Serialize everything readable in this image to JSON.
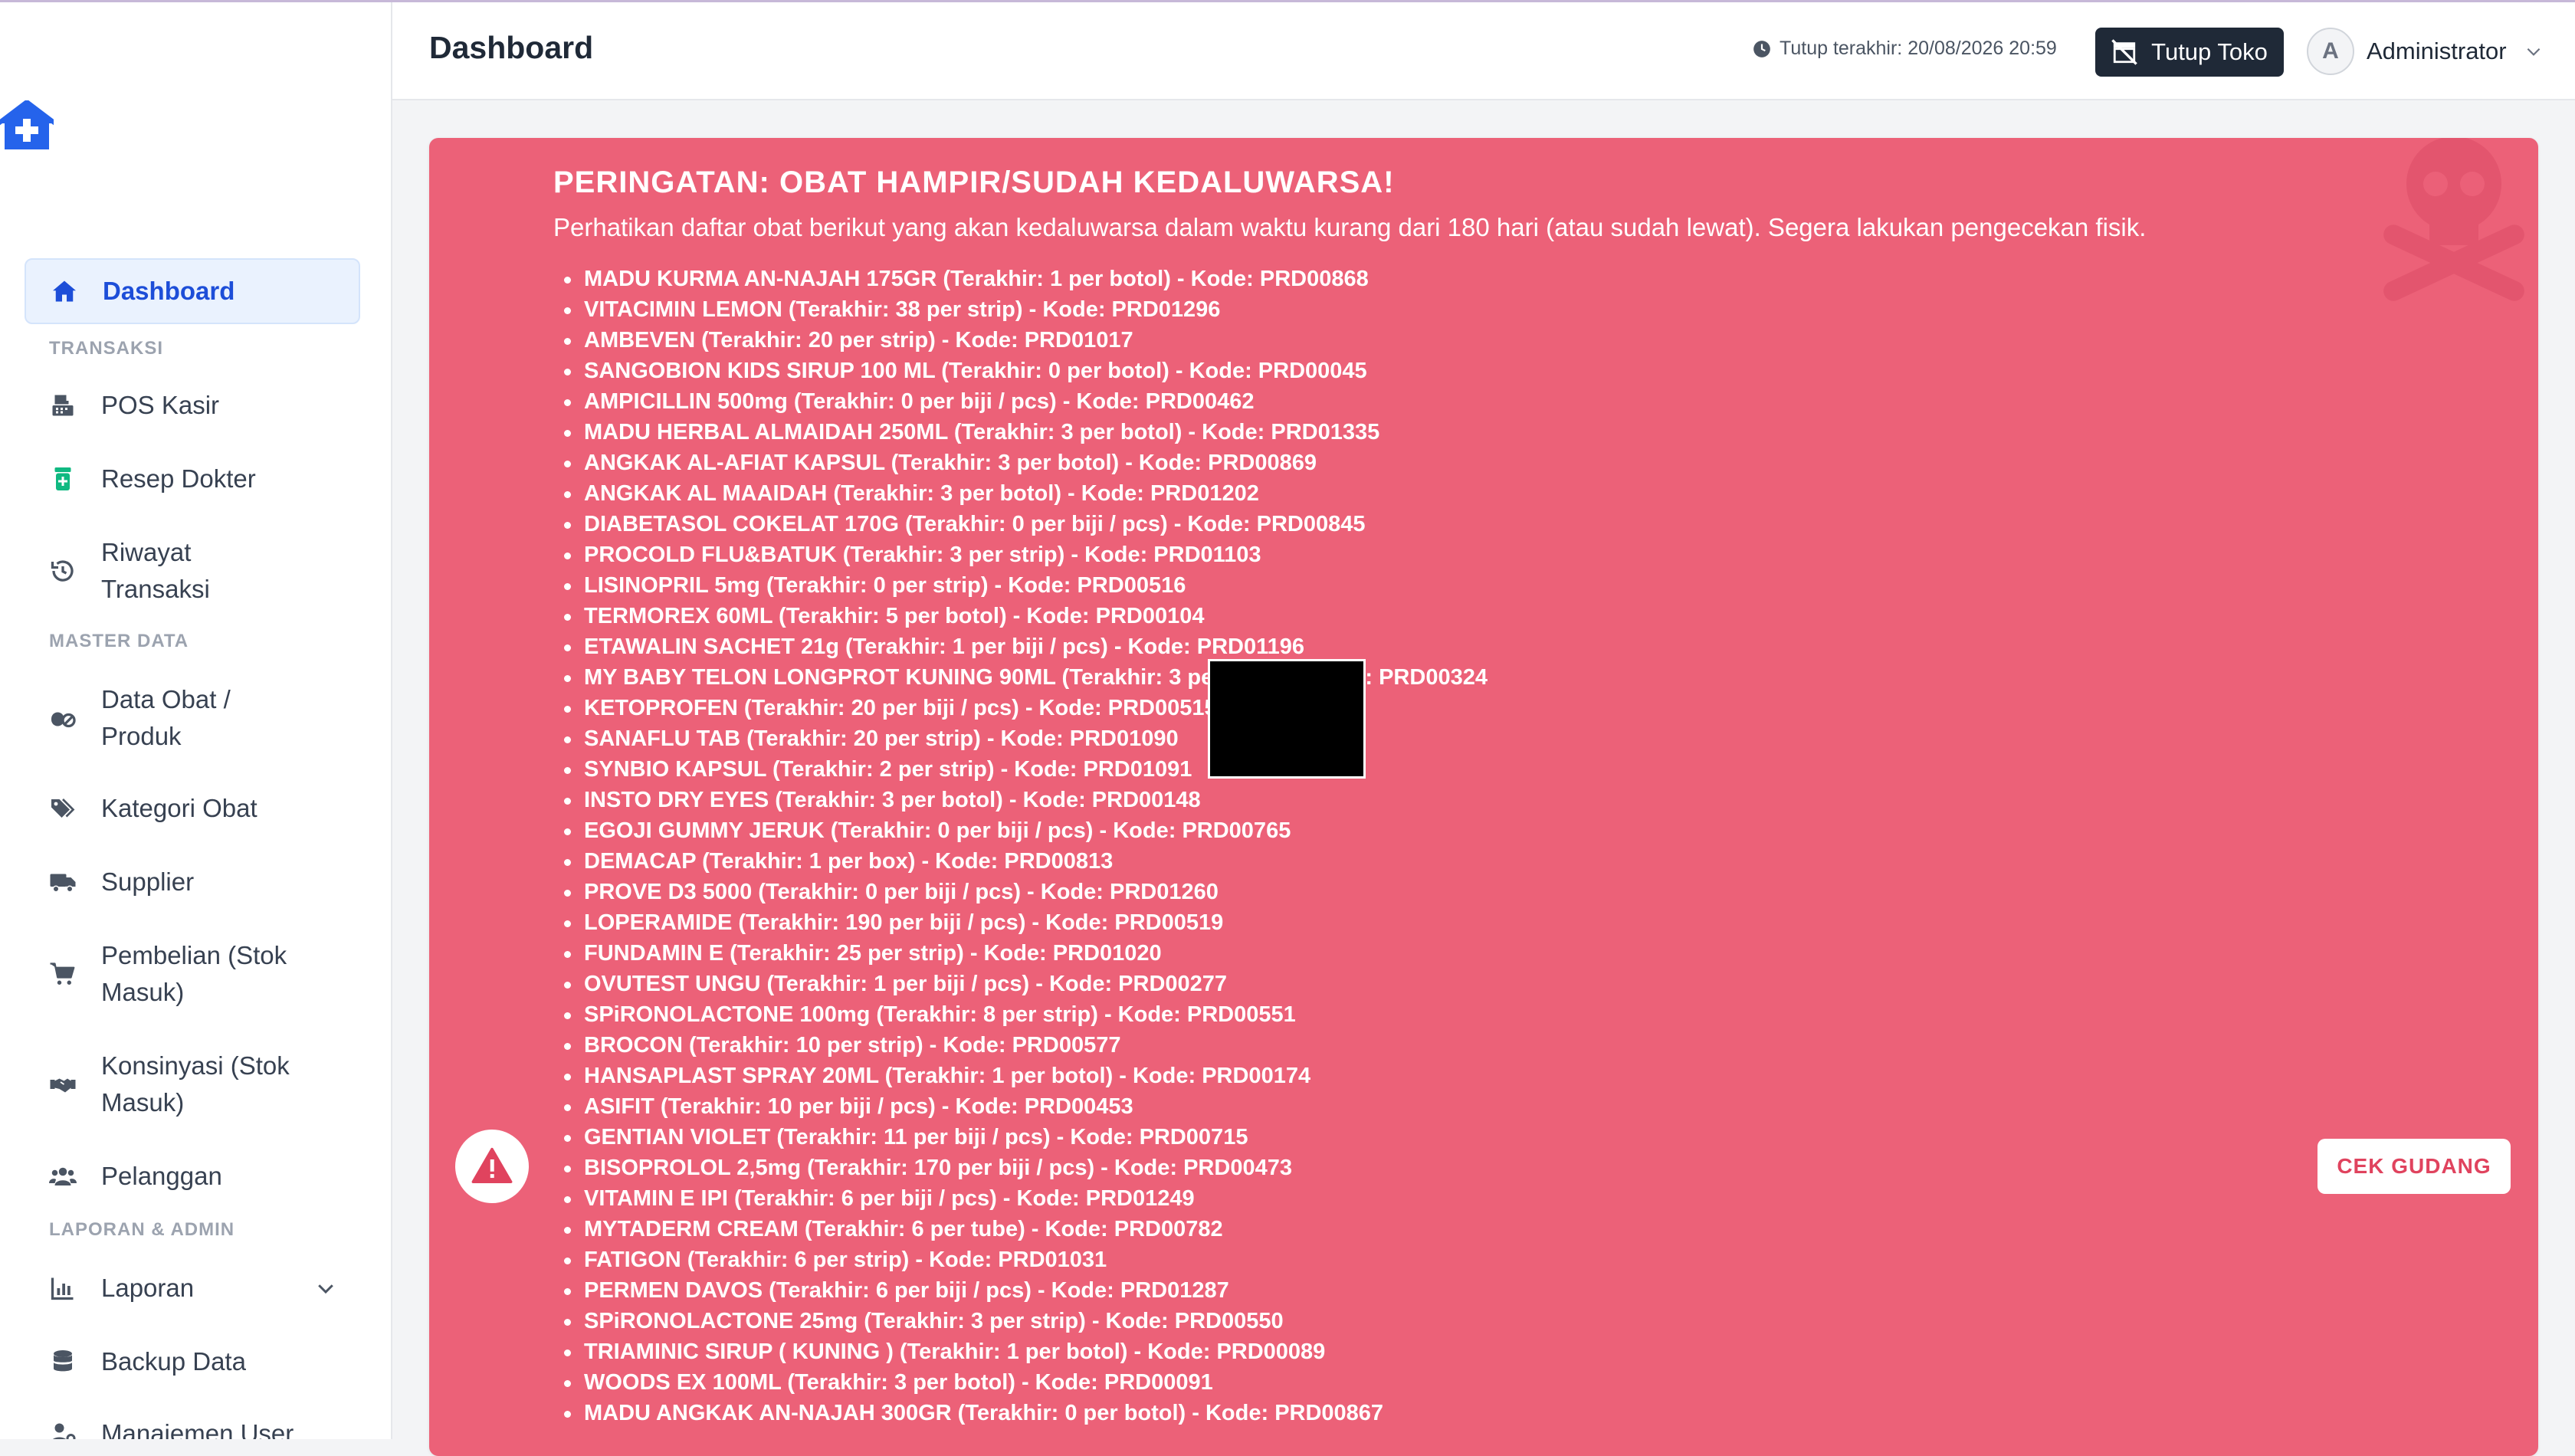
{
  "sidebar": {
    "sections": {
      "transaksi": "TRANSAKSI",
      "master": "MASTER DATA",
      "laporan": "LAPORAN & ADMIN"
    },
    "items": [
      {
        "label": "Dashboard",
        "icon": "home-icon"
      },
      {
        "label": "POS Kasir",
        "icon": "cash-register-icon"
      },
      {
        "label": "Resep Dokter",
        "icon": "prescription-icon"
      },
      {
        "label": "Riwayat\nTransaksi",
        "icon": "history-icon"
      },
      {
        "label": "Data Obat /\nProduk",
        "icon": "pills-icon"
      },
      {
        "label": "Kategori Obat",
        "icon": "tags-icon"
      },
      {
        "label": "Supplier",
        "icon": "truck-icon"
      },
      {
        "label": "Pembelian (Stok\nMasuk)",
        "icon": "cart-icon"
      },
      {
        "label": "Konsinyasi (Stok\nMasuk)",
        "icon": "handshake-icon"
      },
      {
        "label": "Pelanggan",
        "icon": "users-icon"
      },
      {
        "label": "Laporan",
        "icon": "chart-icon"
      },
      {
        "label": "Backup Data",
        "icon": "database-icon"
      },
      {
        "label": "Manajemen User",
        "icon": "user-gear-icon"
      }
    ]
  },
  "header": {
    "title": "Dashboard",
    "last_close": "Tutup terakhir: 20/08/2026 20:59",
    "close_store_label": "Tutup Toko",
    "avatar_initial": "A",
    "user_name": "Administrator"
  },
  "alert": {
    "title": "PERINGATAN: OBAT HAMPIR/SUDAH KEDALUWARSA!",
    "description": "Perhatikan daftar obat berikut yang akan kedaluwarsa dalam waktu kurang dari 180 hari (atau sudah lewat). Segera lakukan pengecekan fisik.",
    "button_label": "CEK GUDANG",
    "items": [
      "MADU KURMA AN-NAJAH 175GR (Terakhir: 1 per botol) - Kode: PRD00868",
      "VITACIMIN LEMON (Terakhir: 38 per strip) - Kode: PRD01296",
      "AMBEVEN (Terakhir: 20 per strip) - Kode: PRD01017",
      "SANGOBION KIDS SIRUP 100 ML (Terakhir: 0 per botol) - Kode: PRD00045",
      "AMPICILLIN 500mg (Terakhir: 0 per biji / pcs) - Kode: PRD00462",
      "MADU HERBAL ALMAIDAH 250ML (Terakhir: 3 per botol) - Kode: PRD01335",
      "ANGKAK AL-AFIAT KAPSUL (Terakhir: 3 per botol) - Kode: PRD00869",
      "ANGKAK AL MAAIDAH (Terakhir: 3 per botol) - Kode: PRD01202",
      "DIABETASOL COKELAT 170G (Terakhir: 0 per biji / pcs) - Kode: PRD00845",
      "PROCOLD FLU&BATUK (Terakhir: 3 per strip) - Kode: PRD01103",
      "LISINOPRIL 5mg (Terakhir: 0 per strip) - Kode: PRD00516",
      "TERMOREX 60ML (Terakhir: 5 per botol) - Kode: PRD00104",
      "ETAWALIN SACHET 21g (Terakhir: 1 per biji / pcs) - Kode: PRD01196",
      "MY BABY TELON LONGPROT KUNING 90ML (Terakhir: 3 per botol) - Kode: PRD00324",
      "KETOPROFEN (Terakhir: 20 per biji / pcs) - Kode: PRD00515",
      "SANAFLU TAB (Terakhir: 20 per strip) - Kode: PRD01090",
      "SYNBIO KAPSUL (Terakhir: 2 per strip) - Kode: PRD01091",
      "INSTO DRY EYES (Terakhir: 3 per botol) - Kode: PRD00148",
      "EGOJI GUMMY JERUK (Terakhir: 0 per biji / pcs) - Kode: PRD00765",
      "DEMACAP (Terakhir: 1 per box) - Kode: PRD00813",
      "PROVE D3 5000 (Terakhir: 0 per biji / pcs) - Kode: PRD01260",
      "LOPERAMIDE (Terakhir: 190 per biji / pcs) - Kode: PRD00519",
      "FUNDAMIN E (Terakhir: 25 per strip) - Kode: PRD01020",
      "OVUTEST UNGU (Terakhir: 1 per biji / pcs) - Kode: PRD00277",
      "SPiRONOLACTONE 100mg (Terakhir: 8 per strip) - Kode: PRD00551",
      "BROCON (Terakhir: 10 per strip) - Kode: PRD00577",
      "HANSAPLAST SPRAY 20ML (Terakhir: 1 per botol) - Kode: PRD00174",
      "ASIFIT (Terakhir: 10 per biji / pcs) - Kode: PRD00453",
      "GENTIAN VIOLET (Terakhir: 11 per biji / pcs) - Kode: PRD00715",
      "BISOPROLOL 2,5mg (Terakhir: 170 per biji / pcs) - Kode: PRD00473",
      "VITAMIN E IPI (Terakhir: 6 per biji / pcs) - Kode: PRD01249",
      "MYTADERM CREAM (Terakhir: 6 per tube) - Kode: PRD00782",
      "FATIGON (Terakhir: 6 per strip) - Kode: PRD01031",
      "PERMEN DAVOS (Terakhir: 6 per biji / pcs) - Kode: PRD01287",
      "SPiRONOLACTONE 25mg (Terakhir: 3 per strip) - Kode: PRD00550",
      "TRIAMINIC SIRUP ( KUNING ) (Terakhir: 1 per botol) - Kode: PRD00089",
      "WOODS EX 100ML (Terakhir: 3 per botol) - Kode: PRD00091",
      "MADU ANGKAK AN-NAJAH 300GR (Terakhir: 0 per botol) - Kode: PRD00867"
    ]
  },
  "colors": {
    "alert_bg": "#ec6178",
    "accent": "#1d4ed8",
    "dark_button": "#1f2937"
  }
}
